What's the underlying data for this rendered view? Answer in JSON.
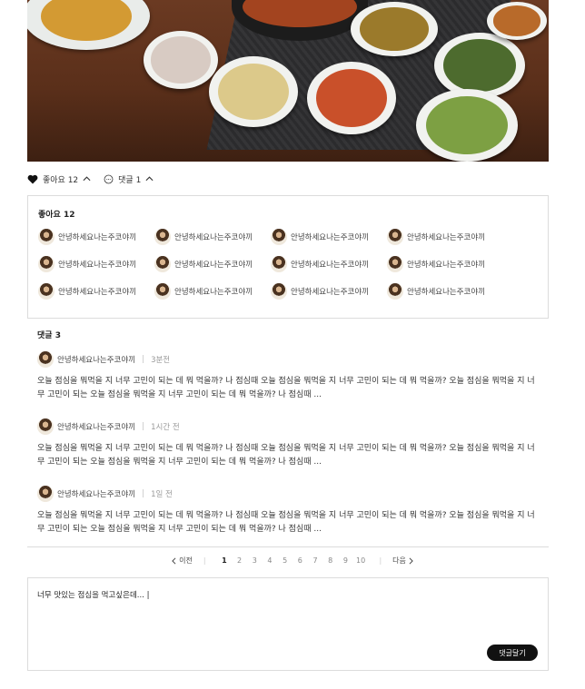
{
  "hero": {
    "image": "korean-meal-photo"
  },
  "reactions": {
    "like_label": "좋아요 12",
    "comment_label": "댓글 1"
  },
  "likes": {
    "title": "좋아요 12",
    "users": [
      "안녕하세요나는주코야끼",
      "안녕하세요나는주코야끼",
      "안녕하세요나는주코야끼",
      "안녕하세요나는주코야끼",
      "안녕하세요나는주코야끼",
      "안녕하세요나는주코야끼",
      "안녕하세요나는주코야끼",
      "안녕하세요나는주코야끼",
      "안녕하세요나는주코야끼",
      "안녕하세요나는주코야끼",
      "안녕하세요나는주코야끼",
      "안녕하세요나는주코야끼"
    ]
  },
  "comments": {
    "title": "댓글 3",
    "items": [
      {
        "author": "안녕하세요나는주코야끼",
        "time": "3분전",
        "text": "오늘 점심을 뭐먹을 지 너무 고민이 되는 데 뭐 먹을까? 나 점심때 오늘 점심을 뭐먹을 지 너무 고민이 되는 데 뭐 먹을까? 오늘 점심을 뭐먹을 지 너무 고민이 되는 오늘 점심을 뭐먹을 지 너무 고민이 되는 데 뭐 먹을까? 나 점심때 ..."
      },
      {
        "author": "안녕하세요나는주코야끼",
        "time": "1시간 전",
        "text": "오늘 점심을 뭐먹을 지 너무 고민이 되는 데 뭐 먹을까? 나 점심때 오늘 점심을 뭐먹을 지 너무 고민이 되는 데 뭐 먹을까? 오늘 점심을 뭐먹을 지 너무 고민이 되는 오늘 점심을 뭐먹을 지 너무 고민이 되는 데 뭐 먹을까? 나 점심때 ..."
      },
      {
        "author": "안녕하세요나는주코야끼",
        "time": "1일 전",
        "text": "오늘 점심을 뭐먹을 지 너무 고민이 되는 데 뭐 먹을까? 나 점심때 오늘 점심을 뭐먹을 지 너무 고민이 되는 데 뭐 먹을까? 오늘 점심을 뭐먹을 지 너무 고민이 되는 오늘 점심을 뭐먹을 지 너무 고민이 되는 데 뭐 먹을까? 나 점심때 ..."
      }
    ]
  },
  "pagination": {
    "prev_label": "이전",
    "next_label": "다음",
    "pages": [
      "1",
      "2",
      "3",
      "4",
      "5",
      "6",
      "7",
      "8",
      "9",
      "10"
    ],
    "current": "1"
  },
  "comment_input": {
    "value": "너무 맛있는 점심을 먹고싶은데... |",
    "submit_label": "댓글달기"
  }
}
